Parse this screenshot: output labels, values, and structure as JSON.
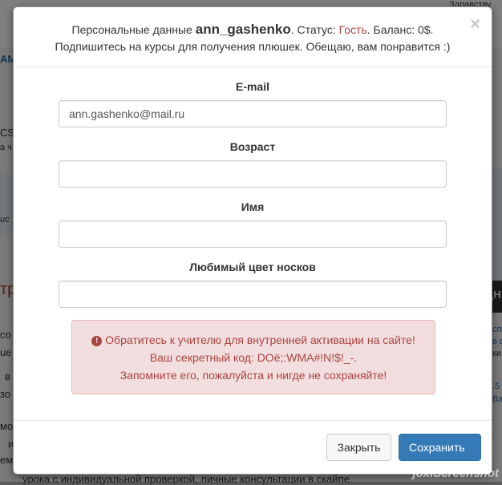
{
  "background": {
    "fragments": [
      "AM",
      "CS",
      "а ч",
      "ис",
      "тр",
      "со",
      "ue",
      "в",
      "зо",
      "мо",
      "и",
      "ем",
      "…",
      "урока с индивидуальной проверкой, личные консультации в скайпе.",
      "Здравству",
      "сп",
      "в а",
      "ки",
      "ДН",
      ".5",
      "Ва"
    ]
  },
  "modal": {
    "header": {
      "prefix": "Персональные данные",
      "username": "ann_gashenko",
      "status_label": ". Статус:",
      "status_value": "Гость",
      "balance": ". Баланс: 0$.",
      "subline": "Подпишитесь на курсы для получения плюшек. Обещаю, вам понравится :)",
      "close_glyph": "×"
    },
    "fields": [
      {
        "label": "E-mail",
        "value": "ann.gashenko@mail.ru"
      },
      {
        "label": "Возраст",
        "value": ""
      },
      {
        "label": "Имя",
        "value": ""
      },
      {
        "label": "Любимый цвет носков",
        "value": ""
      }
    ],
    "alert": {
      "icon": "!",
      "line1": "Обратитесь к учителю для внутренней активации на сайте!",
      "line2": "Ваш секретный код: DOё;:WMA#!N!$!_-.",
      "line3": "Запомните его, пожалуйста и нигде не сохраняйте!"
    },
    "footer": {
      "close_label": "Закрыть",
      "save_label": "Сохранить"
    }
  },
  "watermark": "joxiScreenshot",
  "colors": {
    "status": "#a94442",
    "alert_bg": "#f2dede",
    "primary": "#337ab7"
  }
}
